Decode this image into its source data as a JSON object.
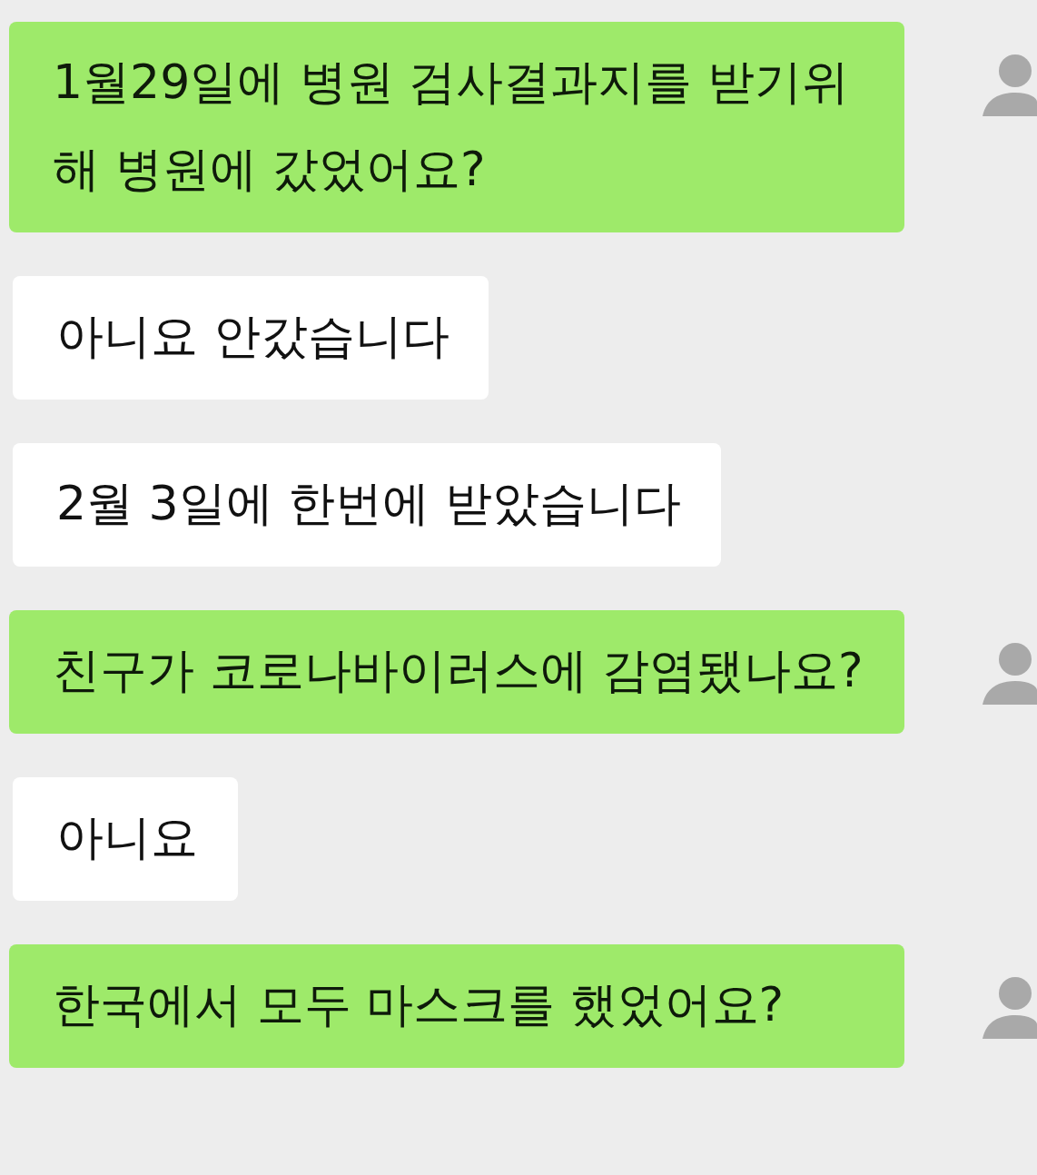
{
  "messages": [
    {
      "kind": "sent",
      "text": "1월29일에 병원 검사결과지를 받기위해 병원에 갔었어요?"
    },
    {
      "kind": "received",
      "text": "아니요 안갔습니다"
    },
    {
      "kind": "received",
      "text": "2월 3일에 한번에 받았습니다"
    },
    {
      "kind": "sent",
      "text": "친구가 코로나바이러스에 감염됐나요?"
    },
    {
      "kind": "received",
      "text": "아니요"
    },
    {
      "kind": "sent",
      "text": "한국에서 모두 마스크를 했었어요?"
    }
  ]
}
